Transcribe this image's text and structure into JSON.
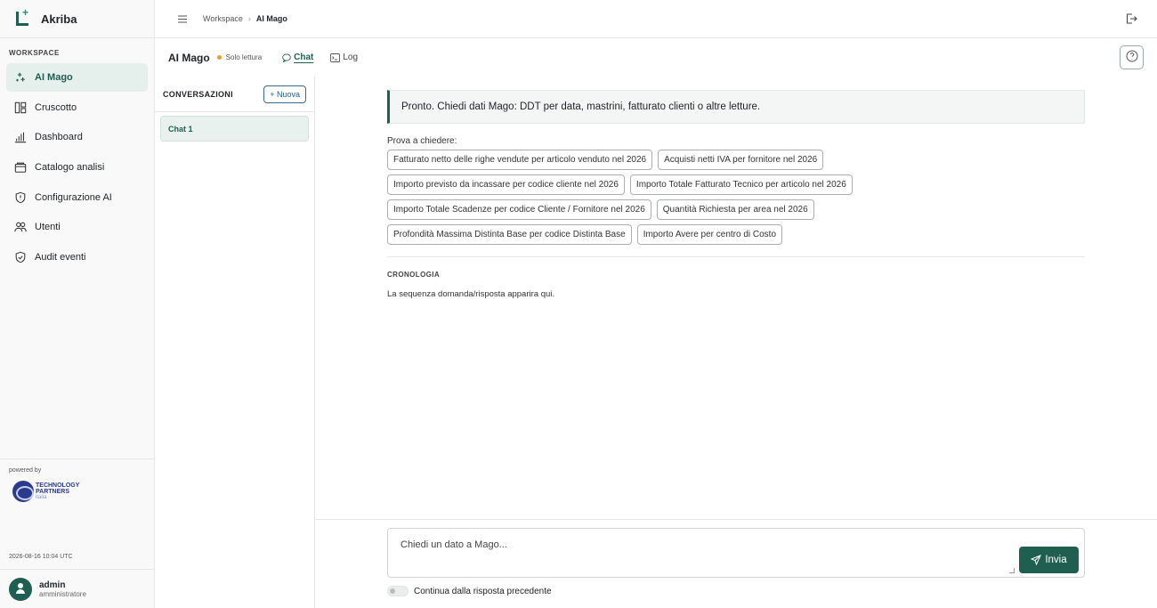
{
  "app": {
    "name": "Akriba"
  },
  "sidebar": {
    "section": "WORKSPACE",
    "items": [
      {
        "label": "AI Mago",
        "icon": "sparkle-icon"
      },
      {
        "label": "Cruscotto",
        "icon": "layout-icon"
      },
      {
        "label": "Dashboard",
        "icon": "bar-chart-icon"
      },
      {
        "label": "Catalogo analisi",
        "icon": "folder-icon"
      },
      {
        "label": "Configurazione AI",
        "icon": "shield-icon"
      },
      {
        "label": "Utenti",
        "icon": "users-icon"
      },
      {
        "label": "Audit eventi",
        "icon": "shield-check-icon"
      }
    ],
    "powered_by": "powered by",
    "partner": {
      "line1": "TECHNOLOGY",
      "line2": "PARTNERS",
      "line3": "italia"
    },
    "timestamp": "2026-08-16 10:04 UTC",
    "user": {
      "name": "admin",
      "role": "amministratore"
    }
  },
  "topbar": {
    "breadcrumb": [
      "Workspace",
      "AI Mago"
    ]
  },
  "page": {
    "title": "AI Mago",
    "status": "Solo lettura",
    "tabs": [
      {
        "label": "Chat",
        "active": true
      },
      {
        "label": "Log",
        "active": false
      }
    ]
  },
  "conversations": {
    "title": "CONVERSAZIONI",
    "new_label": "+ Nuova",
    "items": [
      "Chat 1"
    ]
  },
  "chat": {
    "ready_message": "Pronto. Chiedi dati Mago: DDT per data, mastrini, fatturato clienti o altre letture.",
    "try_label": "Prova a chiedere:",
    "suggestions": [
      [
        "Fatturato netto delle righe vendute per articolo venduto nel 2026",
        "Acquisti netti IVA per fornitore nel 2026"
      ],
      [
        "Importo previsto da incassare per codice cliente nel 2026",
        "Importo Totale Fatturato Tecnico per articolo nel 2026"
      ],
      [
        "Importo Totale Scadenze per codice Cliente / Fornitore nel 2026",
        "Quantità Richiesta per area nel 2026"
      ],
      [
        "Profondità Massima Distinta Base per codice Distinta Base",
        "Importo Avere per centro di Costo"
      ]
    ],
    "history_label": "CRONOLOGIA",
    "history_empty": "La sequenza domanda/risposta apparira qui.",
    "input_placeholder": "Chiedi un dato a Mago...",
    "send_label": "Invia",
    "continue_label": "Continua dalla risposta precedente"
  },
  "colors": {
    "accent": "#1f5f52",
    "status_dot": "#e0a030"
  }
}
